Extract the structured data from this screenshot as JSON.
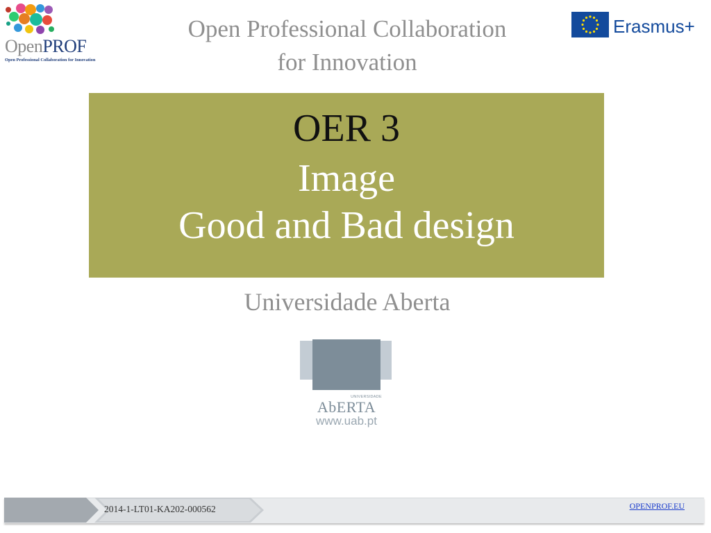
{
  "logos": {
    "openprof": {
      "wordmark_open": "Open",
      "wordmark_prof": "PROF",
      "tagline": "Open Professional Collaboration for Innovation"
    },
    "erasmus": {
      "text": "Erasmus+"
    },
    "uab": {
      "small_text": "UNIVERSIDADE",
      "name": "AbERTA",
      "url": "www.uab.pt"
    }
  },
  "header": {
    "title_line1": "Open Professional Collaboration",
    "title_line2": "for Innovation"
  },
  "title_box": {
    "line1": "OER 3",
    "line2": "Image",
    "line3": "Good and Bad design"
  },
  "subtitle": "Universidade Aberta",
  "footer": {
    "project_code": "2014-1-LT01-KA202-000562",
    "link": "OPENPROF.EU"
  },
  "colors": {
    "title_box_bg": "#a9a957",
    "header_text": "#8f8f8f",
    "eu_blue": "#134a9c",
    "eu_star": "#ffdd00",
    "openprof_blue": "#1f3d7a",
    "uab_dark": "#7d8d99",
    "uab_light": "#c3ccd4",
    "footer_link": "#1a3ccc"
  }
}
